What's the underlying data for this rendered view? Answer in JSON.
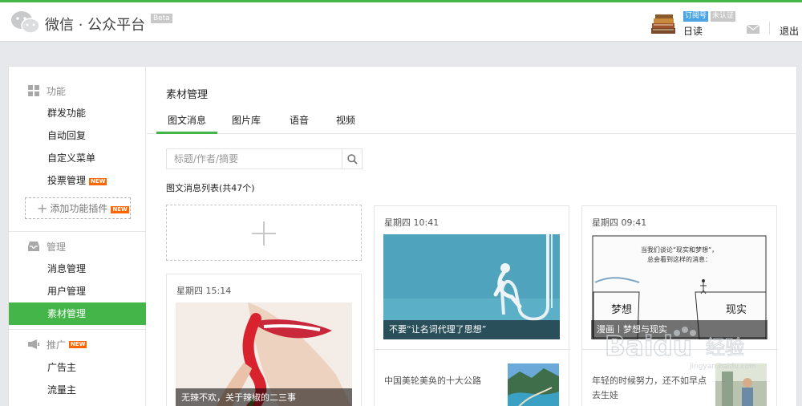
{
  "header": {
    "brand": "微信 · 公众平台",
    "beta": "Beta",
    "account_type": "订阅号",
    "verify_status": "未认证",
    "account_name": "日读",
    "logout": "退出"
  },
  "sidebar": {
    "sections": [
      {
        "title": "功能",
        "icon": "grid-icon",
        "items": [
          {
            "label": "群发功能"
          },
          {
            "label": "自动回复"
          },
          {
            "label": "自定义菜单"
          },
          {
            "label": "投票管理",
            "badge": "NEW"
          }
        ]
      },
      {
        "title": "管理",
        "icon": "inbox-icon",
        "items": [
          {
            "label": "消息管理"
          },
          {
            "label": "用户管理"
          },
          {
            "label": "素材管理",
            "active": true
          }
        ]
      },
      {
        "title": "推广",
        "badge": "NEW",
        "icon": "megaphone-icon",
        "items": [
          {
            "label": "广告主"
          },
          {
            "label": "流量主"
          }
        ]
      }
    ],
    "add_plugin": "添加功能插件",
    "add_plugin_badge": "NEW"
  },
  "main": {
    "title": "素材管理",
    "tabs": [
      {
        "label": "图文消息",
        "active": true
      },
      {
        "label": "图片库"
      },
      {
        "label": "语音"
      },
      {
        "label": "视频"
      }
    ],
    "search_placeholder": "标题/作者/摘要",
    "list_title": "图文消息列表(共47个)",
    "messages": [
      {
        "time": "星期四 15:14",
        "caption": "无辣不欢，关于辣椒的二三事"
      },
      {
        "time": "星期四 10:41",
        "caption": "不要“让名词代理了思想”",
        "sub_title": "中国美轮美奂的十大公路"
      },
      {
        "time": "星期四 09:41",
        "caption": "漫画丨梦想与现实",
        "sub_title": "年轻的时候努力，还不如早点去生娃"
      }
    ]
  },
  "comic_text": {
    "line1": "当我们谈论“现实和梦想”，",
    "line2": "总会看到这样的消息：",
    "left": "梦想",
    "right": "现实"
  },
  "watermark": {
    "text": "Baidu",
    "suffix": "经验",
    "url": "jingyan.baidu.com"
  },
  "colors": {
    "accent": "#44b549",
    "badge": "#ff6600",
    "link_blue": "#4ba4e4"
  }
}
